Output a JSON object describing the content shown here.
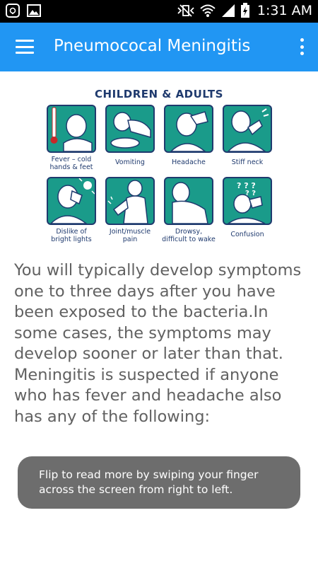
{
  "status_bar": {
    "time": "1:31 AM",
    "icons": [
      "app-notification-icon",
      "image-icon",
      "mute-vibrate-icon",
      "wifi-icon",
      "signal-icon",
      "battery-charging-icon"
    ]
  },
  "app_bar": {
    "title": "Pneumococal Meningitis",
    "menu_icon": "hamburger-menu-icon",
    "overflow_icon": "more-vert-icon"
  },
  "illustration": {
    "title": "CHILDREN & ADULTS",
    "panels": [
      {
        "caption_line1": "Fever – cold",
        "caption_line2": "hands & feet"
      },
      {
        "caption_line1": "Vomiting",
        "caption_line2": ""
      },
      {
        "caption_line1": "Headache",
        "caption_line2": ""
      },
      {
        "caption_line1": "Stiff neck",
        "caption_line2": ""
      },
      {
        "caption_line1": "Dislike of",
        "caption_line2": "bright lights"
      },
      {
        "caption_line1": "Joint/muscle",
        "caption_line2": "pain"
      },
      {
        "caption_line1": "Drowsy,",
        "caption_line2": "difficult to wake"
      },
      {
        "caption_line1": "Confusion",
        "caption_line2": ""
      }
    ],
    "colors": {
      "tile": "#1a9b8a",
      "outline": "#1f3a6e"
    }
  },
  "body": {
    "paragraph": "You will typically develop symptoms one to three days after you have been exposed to  the bacteria.In some cases, the symptoms may develop sooner or later than that. Meningitis is suspected if anyone who has fever and headache also has any of the following:"
  },
  "toast": {
    "message": "Flip to read more by swiping your finger across the screen from right to left."
  },
  "colors": {
    "app_bar": "#2196F3",
    "status_bar": "#000000",
    "body_text": "#616161",
    "toast_bg": "#6d6d6d"
  }
}
